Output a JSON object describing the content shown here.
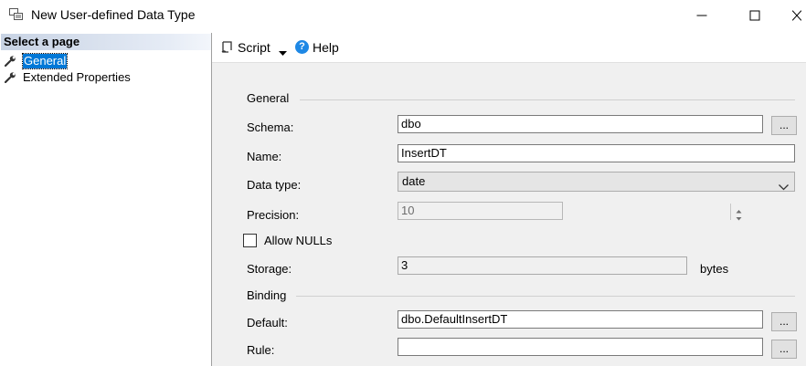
{
  "window": {
    "title": "New User-defined Data Type",
    "icon": "data-type-window-icon"
  },
  "left_pane": {
    "header": "Select a page",
    "items": [
      {
        "label": "General",
        "icon": "wrench-icon",
        "selected": true
      },
      {
        "label": "Extended Properties",
        "icon": "wrench-icon",
        "selected": false
      }
    ]
  },
  "toolbar": {
    "script_label": "Script",
    "help_label": "Help"
  },
  "general": {
    "group_title": "General",
    "schema_label": "Schema:",
    "schema_value": "dbo",
    "name_label": "Name:",
    "name_value": "InsertDT",
    "data_type_label": "Data type:",
    "data_type_value": "date",
    "precision_label": "Precision:",
    "precision_value": "10",
    "allow_nulls_label": "Allow NULLs",
    "allow_nulls_checked": false,
    "storage_label": "Storage:",
    "storage_value": "3",
    "storage_unit": "bytes"
  },
  "binding": {
    "group_title": "Binding",
    "default_label": "Default:",
    "default_value": "dbo.DefaultInsertDT",
    "rule_label": "Rule:",
    "rule_value": ""
  },
  "browse_label": "...",
  "colors": {
    "selection": "#0078d7",
    "content_bg": "#f0f0f0",
    "help_icon": "#1e88e5"
  }
}
